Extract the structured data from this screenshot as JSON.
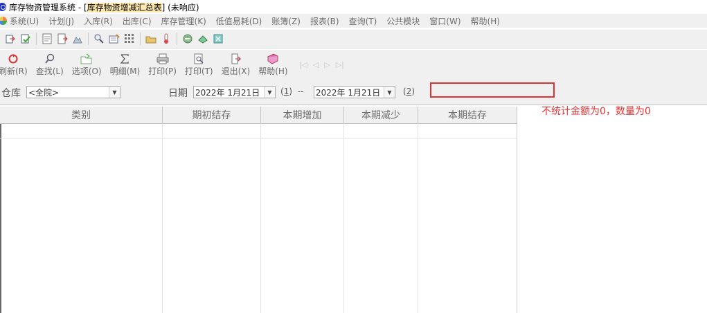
{
  "window": {
    "app_title": "库存物资管理系统",
    "doc_title_prefix": " - [",
    "doc_title": "库存物资增减汇总表",
    "doc_title_suffix": "] (未响应)"
  },
  "menu": [
    "系统(U)",
    "计划(J)",
    "入库(R)",
    "出库(C)",
    "库存管理(K)",
    "低值易耗(D)",
    "账簿(Z)",
    "报表(B)",
    "查询(T)",
    "公共模块",
    "窗口(W)",
    "帮助(H)"
  ],
  "toolbar_buttons": [
    {
      "label": "刷新(R)",
      "icon": "refresh-icon",
      "color": "#d33"
    },
    {
      "label": "查找(L)",
      "icon": "magnifier-icon",
      "color": "#667"
    },
    {
      "label": "选项(O)",
      "icon": "options-folder-icon",
      "color": "#7a7"
    },
    {
      "label": "明细(M)",
      "icon": "sigma-icon",
      "color": "#555"
    },
    {
      "label": "打印(P)",
      "icon": "printer-icon",
      "color": "#777"
    },
    {
      "label": "打印(T)",
      "icon": "print-preview-icon",
      "color": "#777"
    },
    {
      "label": "退出(X)",
      "icon": "exit-door-icon",
      "color": "#a55"
    },
    {
      "label": "帮助(H)",
      "icon": "help-book-icon",
      "color": "#a46"
    }
  ],
  "filter": {
    "warehouse_label": "仓库",
    "warehouse_value": "<全院>",
    "date_label": "日期",
    "date_from": "2022年  1月21日",
    "link1": "1",
    "separator": "--",
    "date_to": "2022年  1月21日",
    "link2": "2"
  },
  "annotation": {
    "note": "不统计金额为0，数量为0",
    "color": "#e03030"
  },
  "table": {
    "columns": [
      "类别",
      "期初结存",
      "本期增加",
      "本期减少",
      "本期结存"
    ],
    "rows": []
  }
}
